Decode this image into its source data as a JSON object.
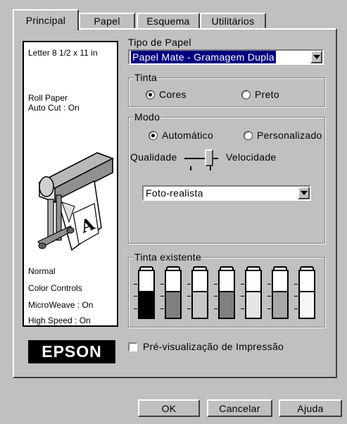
{
  "tabs": [
    {
      "label": "Principal",
      "active": true
    },
    {
      "label": "Papel",
      "active": false
    },
    {
      "label": "Esquema",
      "active": false
    },
    {
      "label": "Utilitários",
      "active": false
    }
  ],
  "info_panel": {
    "paper_size": "Letter 8 1/2 x 11 in",
    "roll_paper": "Roll Paper",
    "auto_cut": "Auto Cut : On",
    "normal": "Normal",
    "color_controls": "Color Controls",
    "microweave": "MicroWeave : On",
    "high_speed": "High Speed : On"
  },
  "media_type": {
    "label": "Tipo de Papel",
    "selected": "Papel Mate - Gramagem Dupla"
  },
  "ink": {
    "title": "Tinta",
    "options": [
      {
        "label": "Cores",
        "selected": true
      },
      {
        "label": "Preto",
        "selected": false
      }
    ]
  },
  "mode": {
    "title": "Modo",
    "options": [
      {
        "label": "Automático",
        "selected": true
      },
      {
        "label": "Personalizado",
        "selected": false
      }
    ],
    "quality_label": "Qualidade",
    "speed_label": "Velocidade",
    "slider_value": "quality",
    "preset": "Foto-realista"
  },
  "ink_levels": {
    "title": "Tinta existente",
    "cartridges": [
      {
        "color": "#000000",
        "level": 0.58
      },
      {
        "color": "#808080",
        "level": 0.58
      },
      {
        "color": "#c8c8c8",
        "level": 0.58
      },
      {
        "color": "#808080",
        "level": 0.58
      },
      {
        "color": "#e6e6e6",
        "level": 0.58
      },
      {
        "color": "#a8a8a8",
        "level": 0.58
      },
      {
        "color": "#f6f6f6",
        "level": 0.58
      }
    ]
  },
  "brand": "EPSON",
  "print_preview": {
    "label": "Pré-visualização de Impressão",
    "checked": false
  },
  "buttons": {
    "ok": "OK",
    "cancel": "Cancelar",
    "help": "Ajuda"
  },
  "icons": {
    "printer": "large-format-printer-icon"
  }
}
